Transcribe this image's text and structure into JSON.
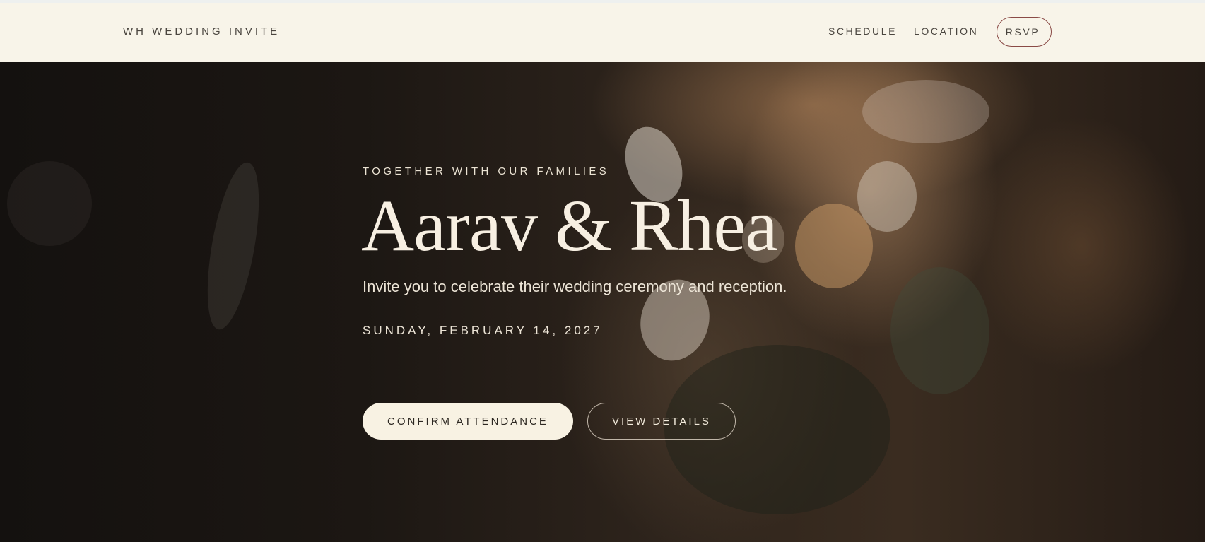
{
  "nav": {
    "brand": "WH WEDDING INVITE",
    "links": [
      {
        "label": "SCHEDULE"
      },
      {
        "label": "LOCATION"
      }
    ],
    "rsvp_label": "RSVP"
  },
  "hero": {
    "eyebrow": "TOGETHER WITH OUR FAMILIES",
    "couple": "Aarav & Rhea",
    "invitation": "Invite you to celebrate their wedding ceremony and reception.",
    "date": "SUNDAY, FEBRUARY 14, 2027",
    "confirm_label": "CONFIRM ATTENDANCE",
    "details_label": "VIEW DETAILS"
  },
  "colors": {
    "nav_background": "#f8f4e9",
    "accent_border": "#8a4a46",
    "hero_text": "#f7efe2",
    "primary_button": "#f8f2e3"
  }
}
